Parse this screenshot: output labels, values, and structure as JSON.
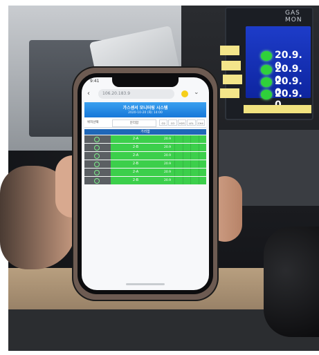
{
  "monitor": {
    "title": "GAS MON",
    "readings": [
      "20.9. 0.",
      "20.9. 0.",
      "20.9. 0.",
      "20.9. 0."
    ]
  },
  "phone": {
    "status_time": "9:41",
    "url": "106.20.183.9",
    "banner": {
      "title": "가스센서 모니터링 시스템",
      "subtitle": "2020-10-20 (화) 14:00"
    },
    "filter": {
      "label": "위치선택",
      "select_value": "분리함",
      "buttons": [
        "O2",
        "CO",
        "H2S",
        "LEL",
        "CH4"
      ]
    },
    "table_header": "가리함",
    "rows": [
      {
        "id": "2-A",
        "value": "20.9"
      },
      {
        "id": "2-B",
        "value": "20.9"
      },
      {
        "id": "2-A",
        "value": "20.9"
      },
      {
        "id": "2-B",
        "value": "20.9"
      },
      {
        "id": "2-A",
        "value": "20.9"
      },
      {
        "id": "2-B",
        "value": "20.9"
      }
    ]
  }
}
